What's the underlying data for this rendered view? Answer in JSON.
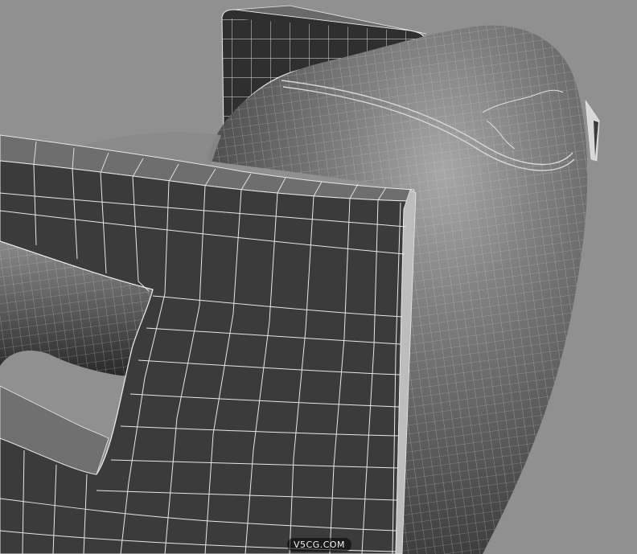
{
  "viewport": {
    "background_color": "#909090",
    "wire_color": "#e8e8e8"
  },
  "watermark": {
    "text": "V5CG.COM"
  }
}
